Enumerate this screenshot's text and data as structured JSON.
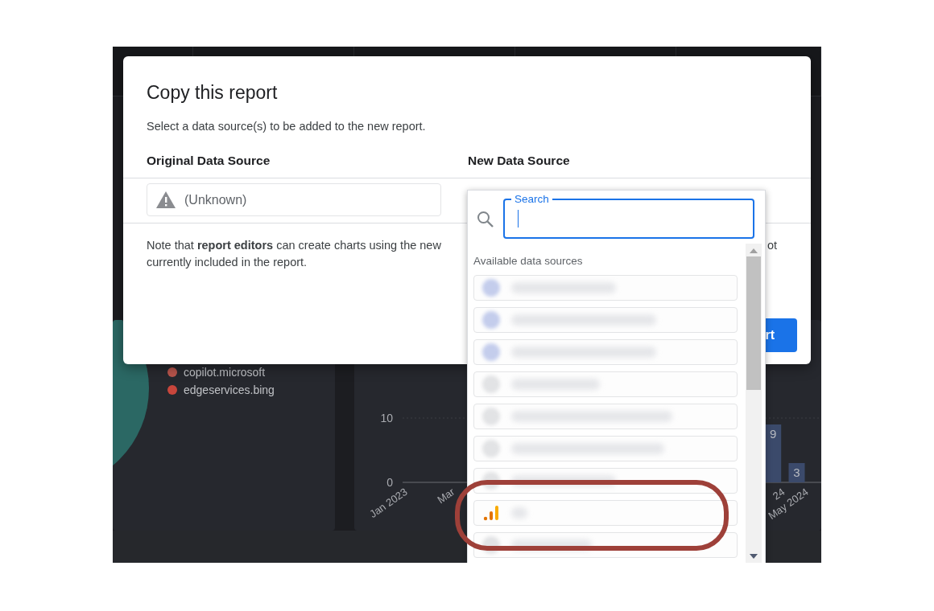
{
  "dashboard": {
    "legend": [
      {
        "label": "copilot.microsoft",
        "color": "#b9554c"
      },
      {
        "label": "edgeservices.bing",
        "color": "#c8463c"
      }
    ],
    "chart_data": {
      "type": "bar",
      "categories": [
        "Jan 2023",
        null,
        "Mar",
        null,
        null,
        null,
        null,
        null,
        null,
        null,
        null,
        null,
        null,
        null,
        null,
        null,
        "24",
        "May 2024",
        null
      ],
      "values": [
        null,
        null,
        null,
        null,
        null,
        null,
        null,
        null,
        null,
        null,
        null,
        null,
        null,
        null,
        null,
        null,
        9,
        3,
        null
      ],
      "value_labels": [
        null,
        null,
        null,
        null,
        null,
        null,
        null,
        null,
        null,
        null,
        null,
        null,
        null,
        null,
        null,
        null,
        "9",
        "3",
        null
      ],
      "ylim": [
        0,
        10
      ],
      "yticks": [
        0,
        10
      ]
    }
  },
  "dialog": {
    "title": "Copy this report",
    "subtitle": "Select a data source(s) to be added to the new report.",
    "columns": [
      "Original Data Source",
      "New Data Source"
    ],
    "original_source": "(Unknown)",
    "note_line_1": "Note that **report editors** can create charts using the new",
    "note_fragment": "ot",
    "note_line_2": "currently included in the report.",
    "button": "rt"
  },
  "dropdown": {
    "search": {
      "label": "Search"
    },
    "section": "Available data sources",
    "items": [
      {
        "kind": "connector"
      },
      {
        "kind": "connector"
      },
      {
        "kind": "connector"
      },
      {
        "kind": "file"
      },
      {
        "kind": "file"
      },
      {
        "kind": "file"
      },
      {
        "kind": "file"
      },
      {
        "kind": "analytics"
      },
      {
        "kind": "file"
      }
    ]
  }
}
